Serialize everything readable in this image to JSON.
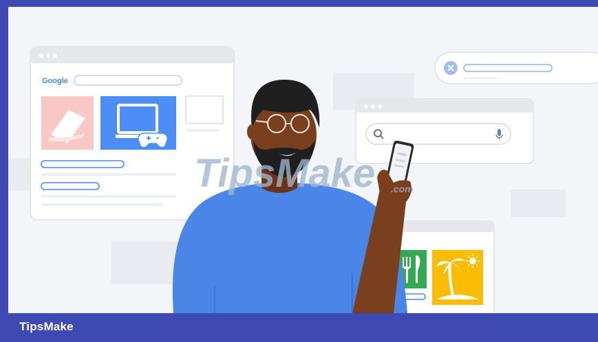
{
  "footer": {
    "brand": "TipsMake"
  },
  "illustration": {
    "browser_left": {
      "logo_text": "Google"
    },
    "watermark": {
      "text": "TipsMake",
      "suffix": ".com"
    }
  },
  "colors": {
    "frame_border": "#3f49b3",
    "background": "#f4f5f8",
    "google_blue": "#4285f4",
    "card_pink": "#f8c9c4",
    "card_blue": "#4c8df6",
    "card_green": "#34a853",
    "card_yellow": "#fbbc04",
    "shirt_blue": "#4a86e8",
    "skin": "#7a3f1c",
    "hair": "#1f1f1f"
  },
  "icons": [
    "laptop-icon",
    "monitor-icon",
    "gamepad-icon",
    "search-icon",
    "mic-icon",
    "close-icon",
    "fork-knife-icon",
    "palm-tree-icon",
    "sun-icon",
    "phone"
  ]
}
